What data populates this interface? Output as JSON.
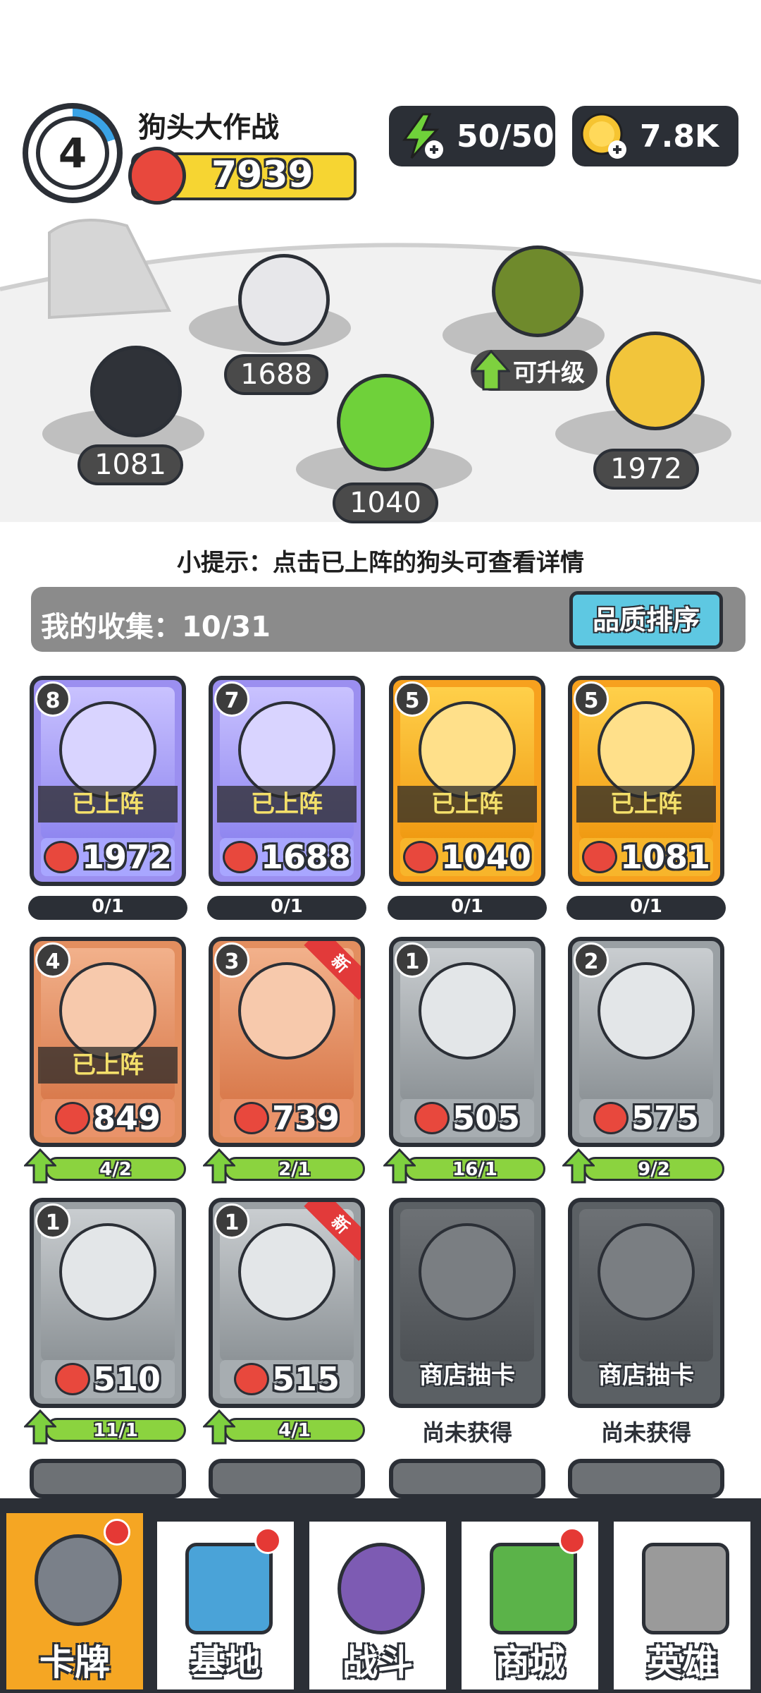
{
  "header": {
    "level": "4",
    "game_title": "狗头大作战",
    "power": "7939",
    "energy": "50/50",
    "coins": "7.8K"
  },
  "arena": {
    "dogs": [
      {
        "name": "ninja-dog",
        "power": "1081"
      },
      {
        "name": "bling-dog",
        "power": "1688"
      },
      {
        "name": "dino-dog",
        "power": "1040"
      },
      {
        "name": "soldier-dog",
        "power": null,
        "upgrade_label": "可升级"
      },
      {
        "name": "golden-warrior-dog",
        "power": "1972"
      }
    ],
    "upgrade_label": "可升级"
  },
  "tip": "小提示：点击已上阵的狗头可查看详情",
  "collection": {
    "label": "我的收集：10/31",
    "sort_button": "品质排序"
  },
  "cards": [
    {
      "level": "8",
      "deployed": "已上阵",
      "power": "1972",
      "progress": "0/1",
      "rarity": "purple"
    },
    {
      "level": "7",
      "deployed": "已上阵",
      "power": "1688",
      "progress": "0/1",
      "rarity": "purple"
    },
    {
      "level": "5",
      "deployed": "已上阵",
      "power": "1040",
      "progress": "0/1",
      "rarity": "gold"
    },
    {
      "level": "5",
      "deployed": "已上阵",
      "power": "1081",
      "progress": "0/1",
      "rarity": "gold"
    },
    {
      "level": "4",
      "deployed": "已上阵",
      "power": "849",
      "progress": "4/2",
      "rarity": "bronze"
    },
    {
      "level": "3",
      "new_badge": "新",
      "power": "739",
      "progress": "2/1",
      "rarity": "bronze"
    },
    {
      "level": "1",
      "power": "505",
      "progress": "16/1",
      "rarity": "gray"
    },
    {
      "level": "2",
      "power": "575",
      "progress": "9/2",
      "rarity": "gray"
    },
    {
      "level": "1",
      "power": "510",
      "progress": "11/1",
      "rarity": "gray"
    },
    {
      "level": "1",
      "new_badge": "新",
      "power": "515",
      "progress": "4/1",
      "rarity": "gray"
    },
    {
      "locked_label": "商店抽卡",
      "status": "尚未获得",
      "rarity": "locked"
    },
    {
      "locked_label": "商店抽卡",
      "status": "尚未获得",
      "rarity": "locked"
    }
  ],
  "nav": {
    "tabs": [
      {
        "label": "卡牌",
        "active": true,
        "dot": true
      },
      {
        "label": "基地",
        "active": false,
        "dot": true
      },
      {
        "label": "战斗",
        "active": false,
        "dot": false
      },
      {
        "label": "商城",
        "active": false,
        "dot": true
      },
      {
        "label": "英雄",
        "active": false,
        "dot": false
      }
    ]
  },
  "colors": {
    "dark": "#2b2f36",
    "gold_bar": "#f6d532",
    "power_red": "#e8483d",
    "sort_blue": "#5ec8e2",
    "progress_green": "#8bd33f",
    "nav_active": "#f5a623"
  }
}
